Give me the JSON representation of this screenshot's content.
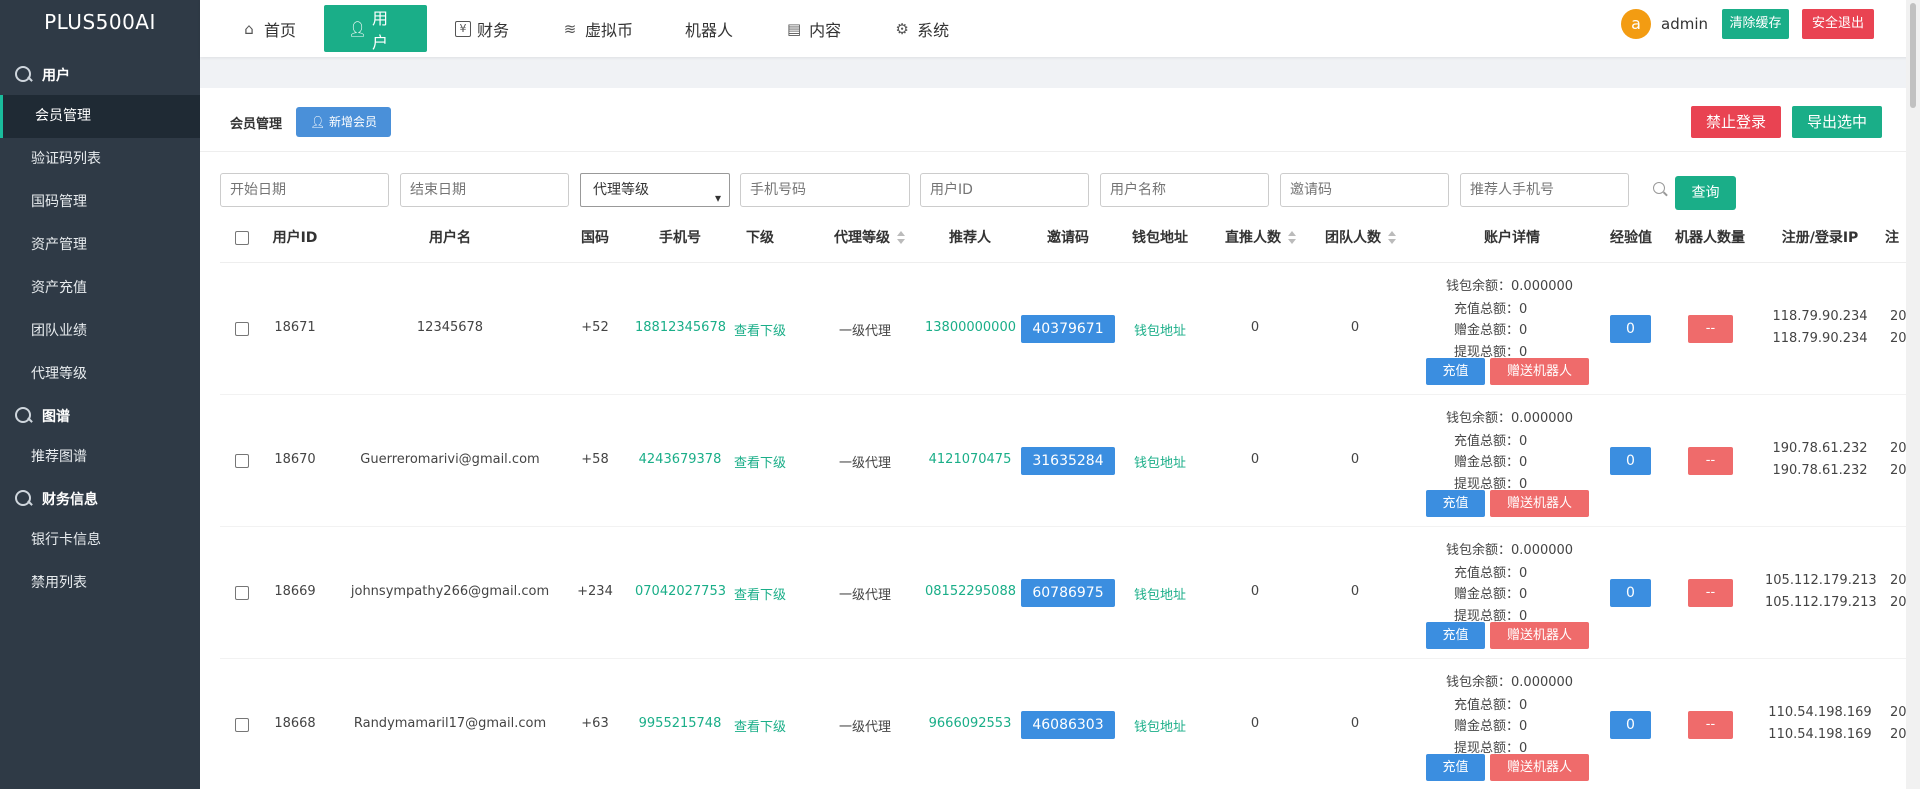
{
  "brand": "PLUS500AI",
  "sidebar": {
    "groups": [
      {
        "label": "用户",
        "items": [
          "会员管理",
          "验证码列表",
          "国码管理",
          "资产管理",
          "资产充值",
          "团队业绩",
          "代理等级"
        ]
      },
      {
        "label": "图谱",
        "items": [
          "推荐图谱"
        ]
      },
      {
        "label": "财务信息",
        "items": [
          "银行卡信息",
          "禁用列表"
        ]
      }
    ],
    "active_item": "会员管理"
  },
  "topnav": [
    {
      "label": "首页",
      "icon": "home-icon"
    },
    {
      "label": "用户",
      "icon": "user-icon"
    },
    {
      "label": "财务",
      "icon": "yen-icon"
    },
    {
      "label": "虚拟币",
      "icon": "database-icon"
    },
    {
      "label": "机器人",
      "icon": ""
    },
    {
      "label": "内容",
      "icon": "document-icon"
    },
    {
      "label": "系统",
      "icon": "gear-icon"
    }
  ],
  "user": {
    "avatar_letter": "a",
    "name": "admin",
    "clear_cache": "清除缓存",
    "logout": "安全退出"
  },
  "panel": {
    "title": "会员管理",
    "add_member": "新增会员",
    "ban_login": "禁止登录",
    "export_selected": "导出选中"
  },
  "filters": {
    "start_date": "开始日期",
    "end_date": "结束日期",
    "agent_level": "代理等级",
    "phone": "手机号码",
    "user_id": "用户ID",
    "user_name": "用户名称",
    "invite_code": "邀请码",
    "referrer_phone": "推荐人手机号",
    "query": "查询"
  },
  "columns": {
    "user_id": "用户ID",
    "username": "用户名",
    "country_code": "国码",
    "phone": "手机号",
    "subordinate": "下级",
    "agent_level": "代理等级",
    "referrer": "推荐人",
    "invite_code": "邀请码",
    "wallet": "钱包地址",
    "direct_count": "直推人数",
    "team_count": "团队人数",
    "account_detail": "账户详情",
    "exp": "经验值",
    "robot_count": "机器人数量",
    "ip": "注册/登录IP",
    "more": "注"
  },
  "account_labels": {
    "balance": "钱包余额：",
    "recharge_total": "充值总额：",
    "gift_total": "赠金总额：",
    "withdraw_total": "提现总额：",
    "recharge_btn": "充值",
    "gift_btn": "赠送机器人"
  },
  "rows": [
    {
      "id": "18671",
      "username": "12345678",
      "cc": "+52",
      "phone": "18812345678",
      "sub": "查看下级",
      "level": "一级代理",
      "referrer": "13800000000",
      "code": "40379671",
      "wallet": "钱包地址",
      "direct": "0",
      "team": "0",
      "balance": "0.000000",
      "recharge": "0",
      "gift": "0",
      "withdraw": "0",
      "exp": "0",
      "robots": "--",
      "reg_ip": "118.79.90.234",
      "login_ip": "118.79.90.234",
      "extra1": "20",
      "extra2": "20"
    },
    {
      "id": "18670",
      "username": "Guerreromarivi@gmail.com",
      "cc": "+58",
      "phone": "4243679378",
      "sub": "查看下级",
      "level": "一级代理",
      "referrer": "4121070475",
      "code": "31635284",
      "wallet": "钱包地址",
      "direct": "0",
      "team": "0",
      "balance": "0.000000",
      "recharge": "0",
      "gift": "0",
      "withdraw": "0",
      "exp": "0",
      "robots": "--",
      "reg_ip": "190.78.61.232",
      "login_ip": "190.78.61.232",
      "extra1": "20",
      "extra2": "20"
    },
    {
      "id": "18669",
      "username": "johnsympathy266@gmail.com",
      "cc": "+234",
      "phone": "07042027753",
      "sub": "查看下级",
      "level": "一级代理",
      "referrer": "08152295088",
      "code": "60786975",
      "wallet": "钱包地址",
      "direct": "0",
      "team": "0",
      "balance": "0.000000",
      "recharge": "0",
      "gift": "0",
      "withdraw": "0",
      "exp": "0",
      "robots": "--",
      "reg_ip": "105.112.179.213",
      "login_ip": "105.112.179.213",
      "extra1": "20",
      "extra2": "20"
    },
    {
      "id": "18668",
      "username": "Randymamaril17@gmail.com",
      "cc": "+63",
      "phone": "9955215748",
      "sub": "查看下级",
      "level": "一级代理",
      "referrer": "9666092553",
      "code": "46086303",
      "wallet": "钱包地址",
      "direct": "0",
      "team": "0",
      "balance": "0.000000",
      "recharge": "0",
      "gift": "0",
      "withdraw": "0",
      "exp": "0",
      "robots": "--",
      "reg_ip": "110.54.198.169",
      "login_ip": "110.54.198.169",
      "extra1": "20",
      "extra2": "20"
    }
  ]
}
